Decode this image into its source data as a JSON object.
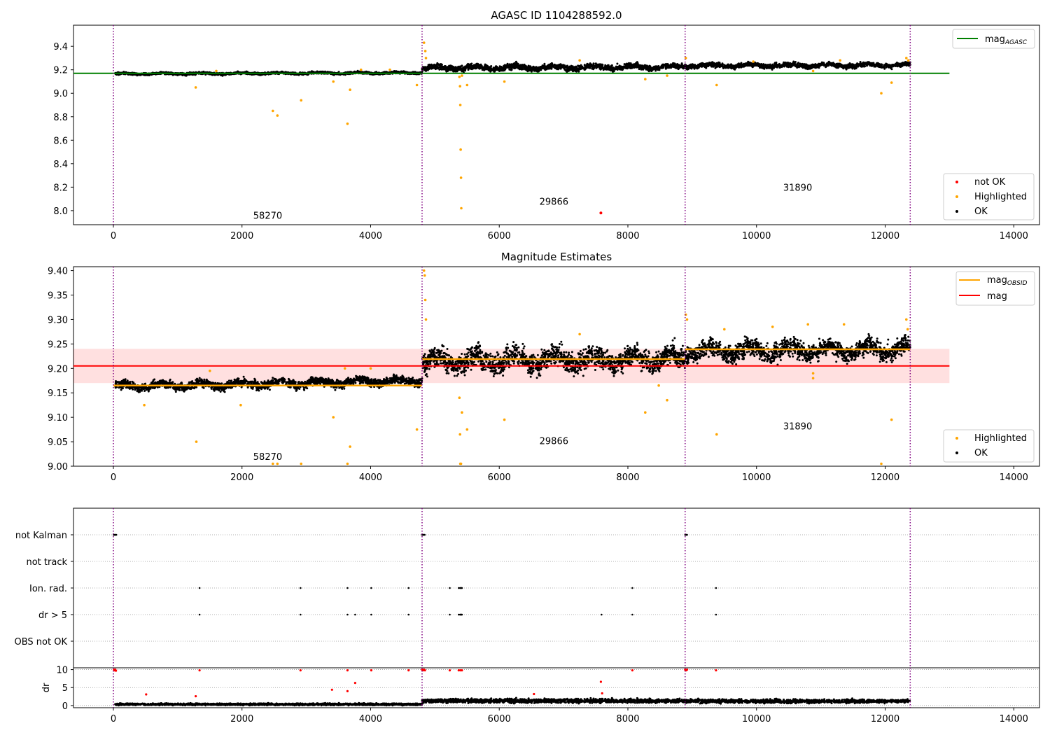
{
  "chart_data": [
    {
      "type": "scatter",
      "title": "AGASC ID 1104288592.0",
      "xlim": [
        -620,
        14400
      ],
      "ylim": [
        7.88,
        9.58
      ],
      "x_ticks": [
        0,
        2000,
        4000,
        6000,
        8000,
        10000,
        12000,
        14000
      ],
      "x_tick_labels": [
        "0",
        "2000",
        "4000",
        "6000",
        "8000",
        "10000",
        "12000",
        "14000"
      ],
      "y_ticks": [
        8.0,
        8.2,
        8.4,
        8.6,
        8.8,
        9.0,
        9.2,
        9.4
      ],
      "y_tick_labels": [
        "8.0",
        "8.2",
        "8.4",
        "8.6",
        "8.8",
        "9.0",
        "9.2",
        "9.4"
      ],
      "obs_boundaries": [
        0,
        4800,
        8890,
        12390
      ],
      "obs_labels": [
        {
          "text": "58270",
          "x": 2400,
          "y": 7.93
        },
        {
          "text": "29866",
          "x": 6850,
          "y": 8.05
        },
        {
          "text": "31890",
          "x": 10640,
          "y": 8.17
        }
      ],
      "mag_agasc": {
        "value": 9.17,
        "x_range": [
          -620,
          13000
        ]
      },
      "ok_segments": [
        {
          "x_range": [
            30,
            4800
          ],
          "baseline": 9.165,
          "trend": 0.01,
          "noise": 0.009
        },
        {
          "x_range": [
            4800,
            8890
          ],
          "baseline": 9.215,
          "trend": 0.01,
          "noise": 0.022
        },
        {
          "x_range": [
            8890,
            12390
          ],
          "baseline": 9.235,
          "trend": 0.005,
          "noise": 0.018
        }
      ],
      "highlighted_points": [
        [
          1280,
          9.05
        ],
        [
          2480,
          8.85
        ],
        [
          2550,
          8.81
        ],
        [
          2920,
          8.94
        ],
        [
          3420,
          9.1
        ],
        [
          3640,
          8.74
        ],
        [
          3680,
          9.03
        ],
        [
          4720,
          9.07
        ],
        [
          4830,
          9.43
        ],
        [
          4850,
          9.36
        ],
        [
          4860,
          9.3
        ],
        [
          5380,
          9.14
        ],
        [
          5390,
          9.06
        ],
        [
          5395,
          8.9
        ],
        [
          5400,
          8.52
        ],
        [
          5405,
          8.28
        ],
        [
          5410,
          8.02
        ],
        [
          5420,
          9.15
        ],
        [
          5500,
          9.07
        ],
        [
          6080,
          9.1
        ],
        [
          7250,
          9.28
        ],
        [
          8270,
          9.12
        ],
        [
          8610,
          9.15
        ],
        [
          8900,
          9.3
        ],
        [
          9380,
          9.07
        ],
        [
          10880,
          9.19
        ],
        [
          11940,
          9.0
        ],
        [
          12100,
          9.09
        ],
        [
          12330,
          9.3
        ],
        [
          12360,
          9.28
        ],
        [
          1600,
          9.19
        ],
        [
          3850,
          9.2
        ],
        [
          4300,
          9.2
        ],
        [
          9950,
          9.27
        ],
        [
          11300,
          9.28
        ]
      ],
      "not_ok_points": [
        [
          7580,
          7.98
        ]
      ],
      "legend_top": [
        "mag$_{AGASC}$"
      ],
      "legend_top_text": {
        "main": "mag",
        "sub": "AGASC"
      },
      "legend_bottom": [
        "not OK",
        "Highlighted",
        "OK"
      ],
      "colors": {
        "ok": "#000000",
        "highlighted": "#ffa500",
        "not_ok": "#ff0000",
        "mag_agasc": "#008000",
        "obs_line": "#800080"
      }
    },
    {
      "type": "scatter",
      "title": "Magnitude Estimates",
      "xlim": [
        -620,
        14400
      ],
      "ylim": [
        9.0,
        9.408
      ],
      "x_ticks": [
        0,
        2000,
        4000,
        6000,
        8000,
        10000,
        12000,
        14000
      ],
      "x_tick_labels": [
        "0",
        "2000",
        "4000",
        "6000",
        "8000",
        "10000",
        "12000",
        "14000"
      ],
      "y_ticks": [
        9.0,
        9.05,
        9.1,
        9.15,
        9.2,
        9.25,
        9.3,
        9.35,
        9.4
      ],
      "y_tick_labels": [
        "9.00",
        "9.05",
        "9.10",
        "9.15",
        "9.20",
        "9.25",
        "9.30",
        "9.35",
        "9.40"
      ],
      "obs_boundaries": [
        0,
        4800,
        8890,
        12390
      ],
      "obs_labels": [
        {
          "text": "58270",
          "x": 2400,
          "y": 9.013
        },
        {
          "text": "29866",
          "x": 6850,
          "y": 9.045
        },
        {
          "text": "31890",
          "x": 10640,
          "y": 9.075
        }
      ],
      "mag": {
        "value": 9.205,
        "band": [
          9.17,
          9.24
        ],
        "x_range": [
          -620,
          13000
        ]
      },
      "mag_obsid": [
        {
          "x_range": [
            0,
            4800
          ],
          "value": 9.165
        },
        {
          "x_range": [
            4800,
            8890
          ],
          "value": 9.219
        },
        {
          "x_range": [
            8890,
            12390
          ],
          "value": 9.239
        }
      ],
      "ok_segments": [
        {
          "x_range": [
            30,
            4800
          ],
          "baseline": 9.163,
          "trend": 0.012,
          "noise": 0.008
        },
        {
          "x_range": [
            4800,
            8890
          ],
          "baseline": 9.215,
          "trend": 0.005,
          "noise": 0.02
        },
        {
          "x_range": [
            8890,
            12390
          ],
          "baseline": 9.235,
          "trend": 0.005,
          "noise": 0.017
        }
      ],
      "highlighted_points": [
        [
          1290,
          9.05
        ],
        [
          2480,
          9.005
        ],
        [
          2550,
          9.005
        ],
        [
          2920,
          9.005
        ],
        [
          3420,
          9.1
        ],
        [
          3640,
          9.005
        ],
        [
          3680,
          9.04
        ],
        [
          4720,
          9.075
        ],
        [
          4830,
          9.4
        ],
        [
          4840,
          9.39
        ],
        [
          4850,
          9.34
        ],
        [
          4860,
          9.3
        ],
        [
          5380,
          9.14
        ],
        [
          5390,
          9.065
        ],
        [
          5395,
          9.005
        ],
        [
          5405,
          9.005
        ],
        [
          5420,
          9.11
        ],
        [
          5500,
          9.075
        ],
        [
          6080,
          9.095
        ],
        [
          7250,
          9.27
        ],
        [
          8270,
          9.11
        ],
        [
          8480,
          9.165
        ],
        [
          8610,
          9.135
        ],
        [
          8900,
          9.31
        ],
        [
          8920,
          9.3
        ],
        [
          9380,
          9.065
        ],
        [
          9500,
          9.28
        ],
        [
          10880,
          9.18
        ],
        [
          10880,
          9.19
        ],
        [
          11940,
          9.005
        ],
        [
          12100,
          9.095
        ],
        [
          12330,
          9.3
        ],
        [
          12350,
          9.28
        ],
        [
          1500,
          9.195
        ],
        [
          1980,
          9.125
        ],
        [
          480,
          9.125
        ],
        [
          3600,
          9.2
        ],
        [
          4000,
          9.2
        ],
        [
          10250,
          9.285
        ],
        [
          10800,
          9.29
        ],
        [
          11360,
          9.29
        ]
      ],
      "legend_top": [
        "mag$_{OBSID}$",
        "mag"
      ],
      "legend_top_text": {
        "main": "mag",
        "sub": "OBSID",
        "second": "mag"
      },
      "legend_bottom": [
        "Highlighted",
        "OK"
      ],
      "colors": {
        "ok": "#000000",
        "highlighted": "#ffa500",
        "mag": "#ff0000",
        "mag_obsid": "#ffa500",
        "band": "#ff0000",
        "obs_line": "#800080"
      }
    },
    {
      "type": "scatter",
      "title": "",
      "xlim": [
        -620,
        14400
      ],
      "flag_rows": [
        "not Kalman",
        "not track",
        "Ion. rad.",
        "dr > 5",
        "OBS not OK"
      ],
      "flag_points": {
        "not Kalman": [
          5,
          15,
          25,
          35,
          45,
          4800,
          4810,
          4820,
          4830,
          4840,
          8890,
          8900,
          8910,
          8920
        ],
        "not track": [],
        "Ion. rad.": [
          1340,
          2910,
          3640,
          4010,
          4590,
          5230,
          5370,
          5390,
          5400,
          5410,
          5420,
          8070,
          9370
        ],
        "dr > 5": [
          1340,
          2910,
          3640,
          3760,
          4010,
          4590,
          5230,
          5370,
          5390,
          5400,
          5410,
          5420,
          7590,
          8070,
          9370
        ],
        "OBS not OK": []
      },
      "dr": {
        "ylim": [
          -0.6,
          10.5
        ],
        "y_ticks": [
          0,
          5,
          10
        ],
        "y_tick_labels": [
          "0",
          "5",
          "10"
        ],
        "ylabel": "dr",
        "outliers": [
          [
            10,
            10
          ],
          [
            20,
            9.8
          ],
          [
            30,
            10
          ],
          [
            40,
            9.7
          ],
          [
            1340,
            9.8
          ],
          [
            2910,
            9.8
          ],
          [
            3640,
            9.8
          ],
          [
            4010,
            9.8
          ],
          [
            4590,
            9.8
          ],
          [
            4800,
            10
          ],
          [
            4815,
            9.8
          ],
          [
            4830,
            10
          ],
          [
            4845,
            9.8
          ],
          [
            5230,
            9.8
          ],
          [
            5370,
            9.8
          ],
          [
            5395,
            9.8
          ],
          [
            5420,
            9.8
          ],
          [
            8070,
            9.8
          ],
          [
            8890,
            10
          ],
          [
            8905,
            9.8
          ],
          [
            8920,
            10
          ],
          [
            9370,
            9.8
          ],
          [
            510,
            3.1
          ],
          [
            1280,
            2.6
          ],
          [
            3400,
            4.4
          ],
          [
            3640,
            4.0
          ],
          [
            3760,
            6.3
          ],
          [
            6540,
            3.2
          ],
          [
            7580,
            6.6
          ],
          [
            7600,
            3.4
          ]
        ],
        "segments": [
          {
            "x_range": [
              30,
              4800
            ],
            "mean": 0.35,
            "noise": 0.25
          },
          {
            "x_range": [
              4800,
              8890
            ],
            "mean": 1.3,
            "noise": 0.55
          },
          {
            "x_range": [
              8890,
              12390
            ],
            "mean": 1.2,
            "noise": 0.5
          }
        ]
      },
      "x_ticks": [
        0,
        2000,
        4000,
        6000,
        8000,
        10000,
        12000,
        14000
      ],
      "x_tick_labels": [
        "0",
        "2000",
        "4000",
        "6000",
        "8000",
        "10000",
        "12000",
        "14000"
      ],
      "obs_boundaries": [
        0,
        4800,
        8890,
        12390
      ],
      "colors": {
        "dr": "#000000",
        "dr_outlier": "#ff0000",
        "flag": "#000000",
        "obs_line": "#800080"
      }
    }
  ]
}
